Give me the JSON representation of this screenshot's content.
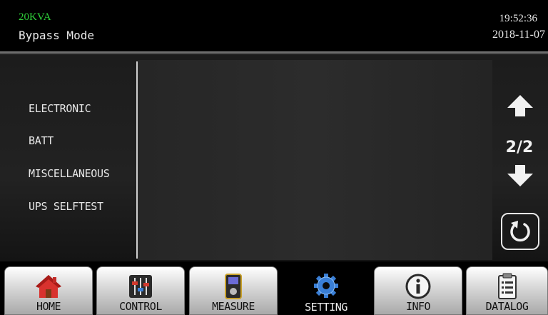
{
  "header": {
    "model": "20KVA",
    "mode": "Bypass Mode",
    "time": "19:52:36",
    "date": "2018-11-07"
  },
  "menu": {
    "items": [
      {
        "label": "ELECTRONIC"
      },
      {
        "label": "BATT"
      },
      {
        "label": "MISCELLANEOUS"
      },
      {
        "label": "UPS SELFTEST"
      }
    ]
  },
  "pager": {
    "indicator": "2/2",
    "up_icon": "arrow-up-icon",
    "down_icon": "arrow-down-icon",
    "refresh_icon": "refresh-icon"
  },
  "nav": {
    "items": [
      {
        "label": "HOME",
        "icon": "home-icon"
      },
      {
        "label": "CONTROL",
        "icon": "sliders-icon"
      },
      {
        "label": "MEASURE",
        "icon": "meter-icon"
      },
      {
        "label": "SETTING",
        "icon": "gear-icon",
        "active": true
      },
      {
        "label": "INFO",
        "icon": "info-icon"
      },
      {
        "label": "DATALOG",
        "icon": "clipboard-icon"
      }
    ]
  },
  "colors": {
    "model_text": "#2fd23a",
    "background": "#000000",
    "active_gear": "#3a7fd6"
  }
}
